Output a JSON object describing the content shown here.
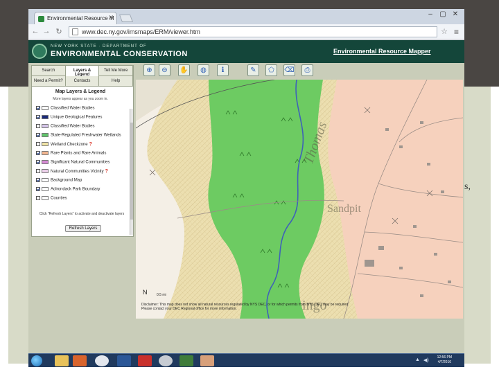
{
  "browser": {
    "tab_title": "Environmental Resource M",
    "tab_close": "✕",
    "url": "www.dec.ny.gov/imsmaps/ERM/viewer.htm",
    "window_controls": [
      "–",
      "▢",
      "✕"
    ]
  },
  "header": {
    "agency_top": "NEW YORK STATE · DEPARTMENT OF",
    "agency_main": "ENVIRONMENTAL CONSERVATION",
    "app_title": "Environmental Resource Mapper"
  },
  "nav": {
    "row1": [
      "Search",
      "Layers & Legend",
      "Tell Me More"
    ],
    "row2": [
      "Need a Permit?",
      "Contacts",
      "Help"
    ]
  },
  "legend": {
    "title": "Map Layers & Legend",
    "note": "More layers appear as you zoom in.",
    "layers": [
      {
        "label": "Classified Water Bodies",
        "checked": true,
        "swatch": "#ffffff",
        "help": ""
      },
      {
        "label": "Unique Geological Features",
        "checked": true,
        "swatch": "#1a2a7a",
        "help": ""
      },
      {
        "label": "Classified Water Bodies",
        "checked": false,
        "swatch": "#d6c6ea",
        "help": ""
      },
      {
        "label": "State-Regulated Freshwater Wetlands",
        "checked": true,
        "swatch": "#5fc46a",
        "help": ""
      },
      {
        "label": "Wetland Checkzone",
        "checked": false,
        "swatch": "#f1e4a6",
        "help": "?"
      },
      {
        "label": "Rare Plants and Rare Animals",
        "checked": true,
        "swatch": "#f2b690",
        "help": ""
      },
      {
        "label": "Significant Natural Communities",
        "checked": true,
        "swatch": "#d58ad4",
        "help": ""
      },
      {
        "label": "Natural Communities Vicinity",
        "checked": false,
        "swatch": "#ecd0ea",
        "help": "?"
      },
      {
        "label": "Background Map",
        "checked": true,
        "swatch": "#ffffff",
        "help": ""
      },
      {
        "label": "Adirondack Park Boundary",
        "checked": true,
        "swatch": "#ffffff",
        "help": ""
      },
      {
        "label": "Counties",
        "checked": false,
        "swatch": "#ffffff",
        "help": ""
      }
    ],
    "refresh_note": "Click \"Refresh Layers\" to activate and deactivate layers",
    "refresh_button": "Refresh Layers"
  },
  "toolbar": {
    "tools": [
      "zoom-in-icon",
      "zoom-out-icon",
      "pan-hand-icon",
      "globe-icon",
      "info-icon",
      "measure-icon",
      "draw-icon",
      "eraser-icon",
      "print-icon"
    ],
    "glyphs": [
      "⊕",
      "⊖",
      "✋",
      "◍",
      "ℹ",
      "✎",
      "⬠",
      "⌫",
      "⎙"
    ]
  },
  "map": {
    "labels": [
      "Thomas",
      "Sandpit",
      "ingo"
    ],
    "scale": "0.5 mi",
    "north": "N",
    "disclaimer": "Disclaimer: This map does not show all natural resources regulated by NYS DEC, or for which permits from NYS DEC may be required. Please contact your DEC Regional office for more information.",
    "colors": {
      "wetland": "#6dcb62",
      "checkzone": "#eadfaa",
      "rare": "#f7cdb6",
      "water": "#3e62b8"
    }
  },
  "taskbar": {
    "time": "12:56 PM",
    "date": "4/7/2016"
  },
  "slide": {
    "bullet_fragment": "s,"
  }
}
